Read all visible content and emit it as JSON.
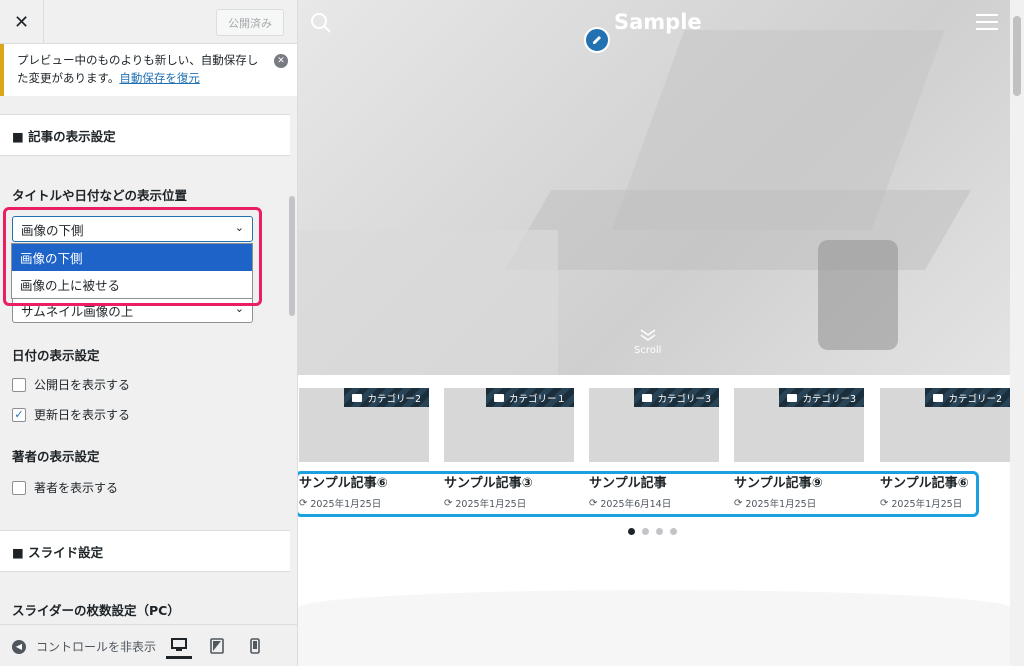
{
  "header": {
    "close_label": "✕",
    "publish_label": "公開済み"
  },
  "notice": {
    "text": "プレビュー中のものよりも新しい、自動保存した変更があります。",
    "restore_link": "自動保存を復元"
  },
  "sections": {
    "post_display_title": "■ 記事の表示設定",
    "position_label": "タイトルや日付などの表示位置",
    "position_value": "画像の下側",
    "position_options": [
      "画像の下側",
      "画像の上に被せる"
    ],
    "category_value": "サムネイル画像の上",
    "date_label": "日付の表示設定",
    "date_opt_published": "公開日を表示する",
    "date_opt_updated": "更新日を表示する",
    "author_label": "著者の表示設定",
    "author_opt": "著者を表示する",
    "slide_title": "■ スライド設定",
    "slider_count_label": "スライダーの枚数設定（PC）"
  },
  "footer": {
    "collapse_label": "コントロールを非表示"
  },
  "preview": {
    "site_title": "Sample",
    "scroll_label": "Scroll",
    "cards": [
      {
        "category": "カテゴリー2",
        "title": "サンプル記事⑥",
        "date": "2025年1月25日"
      },
      {
        "category": "カテゴリー１",
        "title": "サンプル記事③",
        "date": "2025年1月25日"
      },
      {
        "category": "カテゴリー3",
        "title": "サンプル記事",
        "date": "2025年6月14日"
      },
      {
        "category": "カテゴリー3",
        "title": "サンプル記事⑨",
        "date": "2025年1月25日"
      },
      {
        "category": "カテゴリー2",
        "title": "サンプル記事⑥",
        "date": "2025年1月25日"
      }
    ],
    "pager_count": 4,
    "pager_active": 0
  },
  "colors": {
    "accent": "#2271b1",
    "highlight_pink": "#e91e63",
    "highlight_blue": "#1ba0e0",
    "notice_warning": "#dba617"
  }
}
